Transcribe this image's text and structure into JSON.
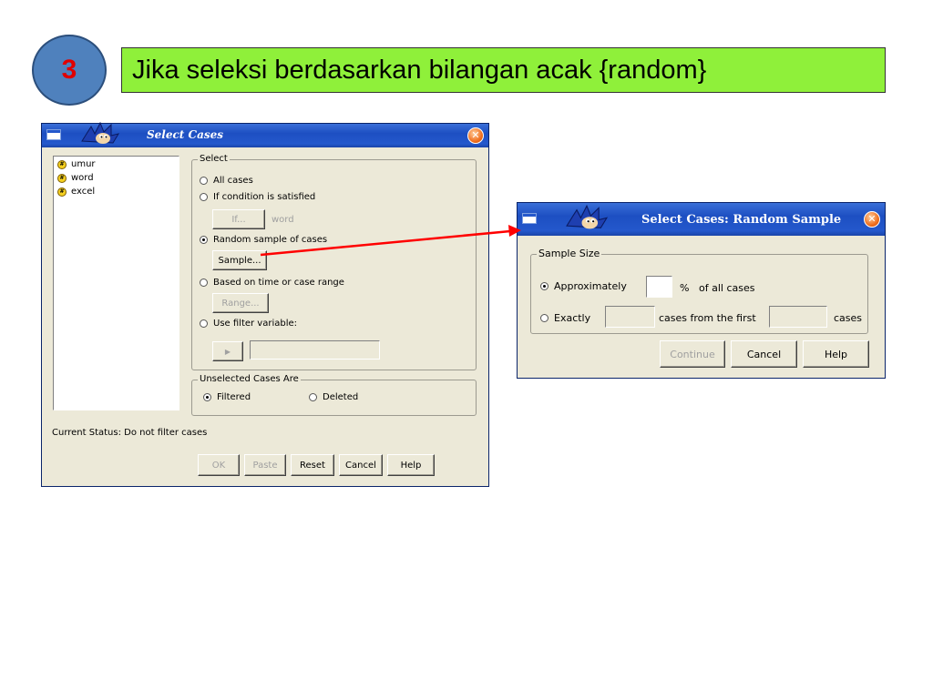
{
  "step": {
    "number": "3"
  },
  "heading": {
    "text": "Jika seleksi berdasarkan bilangan acak {random}"
  },
  "select_cases": {
    "title": "Select Cases",
    "variables": [
      "umur",
      "word",
      "excel"
    ],
    "select_group": {
      "legend": "Select",
      "options": [
        "All cases",
        "If condition is satisfied",
        "Random sample of cases",
        "Based on time or case range",
        "Use filter variable:"
      ],
      "selected": "Random sample of cases",
      "if_button": "If...",
      "if_value": "word",
      "sample_button": "Sample...",
      "range_button": "Range...",
      "arrow_button": "▶"
    },
    "unselected_group": {
      "legend": "Unselected Cases Are",
      "options": [
        "Filtered",
        "Deleted"
      ],
      "selected": "Filtered"
    },
    "status": "Current Status: Do not filter cases",
    "buttons": {
      "ok": "OK",
      "paste": "Paste",
      "reset": "Reset",
      "cancel": "Cancel",
      "help": "Help"
    }
  },
  "random_sample": {
    "title": "Select Cases: Random Sample",
    "group_legend": "Sample Size",
    "approx_label": "Approximately",
    "percent_symbol": "%",
    "of_all_cases": "of all cases",
    "exactly_label": "Exactly",
    "cases_from_first": "cases from the first",
    "cases_label": "cases",
    "selected": "Approximately",
    "buttons": {
      "continue": "Continue",
      "cancel": "Cancel",
      "help": "Help"
    }
  },
  "colors": {
    "accent": "#8ff03a",
    "circle": "#4f81bd",
    "step_number": "#e00000",
    "arrow": "#ff0000"
  }
}
